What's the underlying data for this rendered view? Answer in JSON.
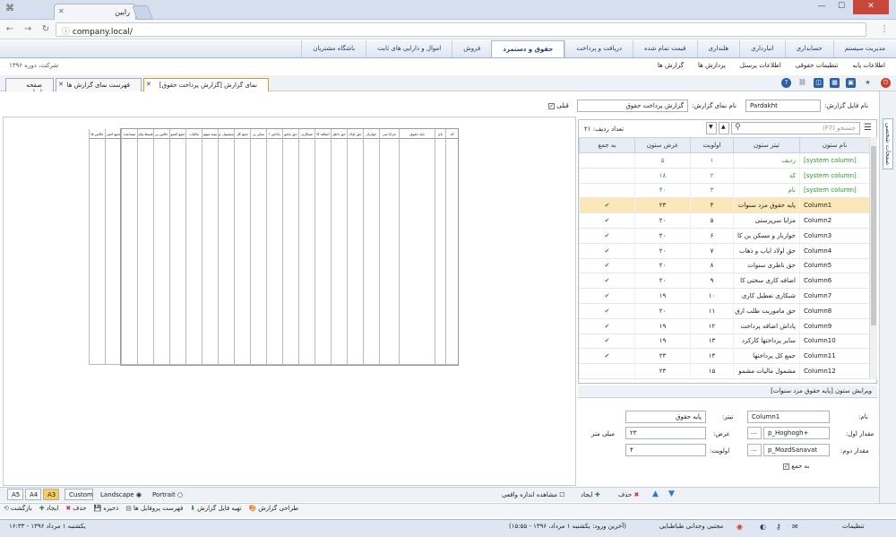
{
  "browser": {
    "tab_title": "رایین",
    "url": "company.local/"
  },
  "menu": {
    "items": [
      "مدیریت سیستم",
      "حسابداری",
      "انبارداری",
      "هلنداری",
      "قیمت تمام شده",
      "دریافت و پرداخت",
      "حقوق و دستمزد",
      "فروش",
      "اموال و دارایی های ثابت",
      "باشگاه مشتریان"
    ],
    "selected": "حقوق و دستمزد"
  },
  "submenu": {
    "items": [
      "اطلاعات پایه",
      "تنظیمات حقوقی",
      "اطلاعات پرسنل",
      "پردازش ها",
      "گزارش ها"
    ],
    "company": "شرکت، دوره ۱۳۹۶"
  },
  "tabs": [
    {
      "label": "نمای گزارش [گزارش پرداخت حقوق]",
      "active": true
    },
    {
      "label": "فهرست نمای گزارش ها",
      "active": false
    },
    {
      "label": "صفحه اصلی",
      "active": false
    }
  ],
  "form": {
    "file_name_label": "نام فایل گزارش:",
    "file_name_value": "Pardakht",
    "view_name_label": "نام نمای گزارش:",
    "view_name_value": "گزارش پرداخت حقوق",
    "default_label": "قبلی"
  },
  "grid": {
    "search_placeholder": "جستجو (F7)",
    "row_count": "تعداد ردیف: ۲۱",
    "headers": [
      "نام ستون",
      "تیتر ستون",
      "اولویت",
      "عرض ستون",
      "به جمع"
    ],
    "rows": [
      {
        "name": "[system column]",
        "title": "ردیف",
        "prio": "۱",
        "width": "۵",
        "sum": false,
        "sys": true
      },
      {
        "name": "[system column]",
        "title": "کد",
        "prio": "۲",
        "width": "۱۸",
        "sum": false,
        "sys": true
      },
      {
        "name": "[system column]",
        "title": "نام",
        "prio": "۳",
        "width": "۴۰",
        "sum": false,
        "sys": true
      },
      {
        "name": "Column1",
        "title": "پایه حقوق مزد سنوات",
        "prio": "۴",
        "width": "۲۳",
        "sum": true,
        "sel": true
      },
      {
        "name": "Column2",
        "title": "مزایا سرپرستی",
        "prio": "۵",
        "width": "۲۰",
        "sum": true
      },
      {
        "name": "Column3",
        "title": "خواربار و مسکن بن کا",
        "prio": "۶",
        "width": "۲۰",
        "sum": true
      },
      {
        "name": "Column4",
        "title": "حق اولاد ایاب و ذهاب",
        "prio": "۷",
        "width": "۲۰",
        "sum": true
      },
      {
        "name": "Column5",
        "title": "حق ناظری سنوات",
        "prio": "۸",
        "width": "۲۰",
        "sum": true
      },
      {
        "name": "Column6",
        "title": "اضافه کاری سختی کا",
        "prio": "۹",
        "width": "۲۰",
        "sum": true
      },
      {
        "name": "Column7",
        "title": "شبکاری تعطیل کاری",
        "prio": "۱۰",
        "width": "۱۹",
        "sum": true
      },
      {
        "name": "Column8",
        "title": "حق ماموریت طلب ازق",
        "prio": "۱۱",
        "width": "۲۰",
        "sum": true
      },
      {
        "name": "Column9",
        "title": "پاداش اضافه پرداخت",
        "prio": "۱۲",
        "width": "۱۹",
        "sum": true
      },
      {
        "name": "Column10",
        "title": "سایر پرداختها کارکرد",
        "prio": "۱۳",
        "width": "۱۹",
        "sum": true
      },
      {
        "name": "Column11",
        "title": "جمع کل پرداختها",
        "prio": "۱۴",
        "width": "۲۳",
        "sum": true
      },
      {
        "name": "Column12",
        "title": "مشمول مالیات مشمو",
        "prio": "۱۵",
        "width": "۲۳",
        "sum": false
      }
    ]
  },
  "edit": {
    "header": "ویرایش ستون [پایه حقوق مزد سنوات]",
    "name_label": "نام:",
    "name_value": "Column1",
    "title_label": "تیتر:",
    "title_value": "پایه حقوق",
    "first_label": "مقدار اول:",
    "first_value": "p_Hoghogh+",
    "width_label": "عرض:",
    "width_value": "۲۳",
    "width_unit": "میلی متر",
    "second_label": "مقدار دوم:",
    "second_value": "p_MozdSanavat",
    "prio_label": "اولویت:",
    "prio_value": "۴",
    "sum_label": "به جمع",
    "dots": "..."
  },
  "bottom": {
    "paper_sizes": [
      "A5",
      "A4",
      "A3",
      "Custom"
    ],
    "paper_selected": "A3",
    "landscape": "Landscape",
    "portrait": "Portrait",
    "real_size": "مشاهده اندازه واقعی",
    "add": "ایجاد",
    "delete": "حذف"
  },
  "actions": [
    "بازگشت",
    "ایجاد",
    "حذف",
    "ذخیره",
    "فهرست پروفایل ها",
    "تهیه فایل گزارش",
    "طراحی گزارش"
  ],
  "status": {
    "settings": "تنظیمات",
    "user": "مجتبی وجدانی طباطبایی",
    "last_login": "(آخرین ورود: یکشنبه ۱ مرداد، ۱۳۹۶ - ۱۵:۵۵)",
    "date": "یکشنبه ۱ مرداد ۱۳۹۶ - ۱۶:۳۳"
  },
  "preview_headers": [
    "کد",
    "نام",
    "پایه حقوق",
    "مزایا سر",
    "خواربار",
    "حق اولاد",
    "حق ناظر",
    "اضافه کا",
    "شبکاری",
    "حق مامو",
    "پاداش ا",
    "سایر پر",
    "جمع کل",
    "مشمول م",
    "بیمه سهم",
    "مالیات",
    "جمع کسو",
    "خالص پر",
    "قسط وام",
    "مساعده",
    "جمع کسر",
    "خالص قا"
  ]
}
